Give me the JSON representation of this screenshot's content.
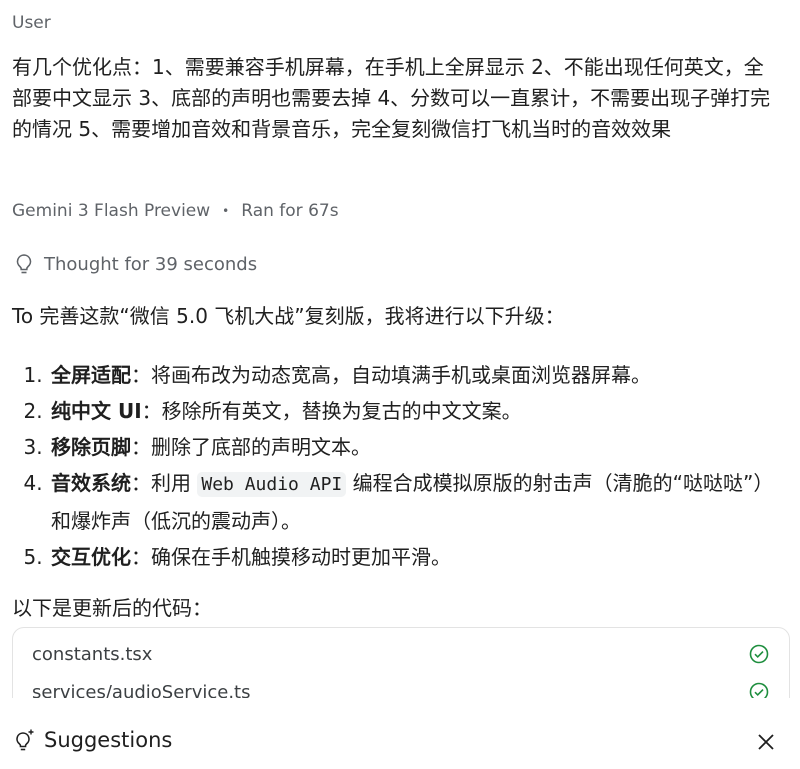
{
  "chat": {
    "role_label": "User",
    "user_message": "有几个优化点：1、需要兼容手机屏幕，在手机上全屏显示 2、不能出现任何英文，全部要中文显示 3、底部的声明也需要去掉 4、分数可以一直累计，不需要出现子弹打完的情况 5、需要增加音效和背景音乐，完全复刻微信打飞机当时的音效效果",
    "model_name": "Gemini 3 Flash Preview",
    "separator": "•",
    "run_time": "Ran for 67s",
    "thought_label": "Thought for 39 seconds",
    "intro": "To 完善这款“微信 5.0 飞机大战”复刻版，我将进行以下升级：",
    "steps": [
      {
        "title": "全屏适配",
        "text": "：将画布改为动态宽高，自动填满手机或桌面浏览器屏幕。"
      },
      {
        "title": "纯中文 UI",
        "text": "：移除所有英文，替换为复古的中文文案。"
      },
      {
        "title": "移除页脚",
        "text": "：删除了底部的声明文本。"
      },
      {
        "title": "音效系统",
        "text_before": "：利用 ",
        "code": "Web Audio API",
        "text_after": " 编程合成模拟原版的射击声（清脆的“哒哒哒”）和爆炸声（低沉的震动声）。"
      },
      {
        "title": "交互优化",
        "text": "：确保在手机触摸移动时更加平滑。"
      }
    ],
    "outro": "以下是更新后的代码：",
    "files": [
      {
        "name": "constants.tsx",
        "status_icon": "check-circle-icon"
      },
      {
        "name": "services/audioService.ts",
        "status_icon": "check-circle-icon"
      }
    ],
    "accent_green": "#1e8e3e"
  },
  "suggestions": {
    "label": "Suggestions",
    "icon": "lightbulb-sparkle-icon",
    "close_icon": "close-icon"
  }
}
